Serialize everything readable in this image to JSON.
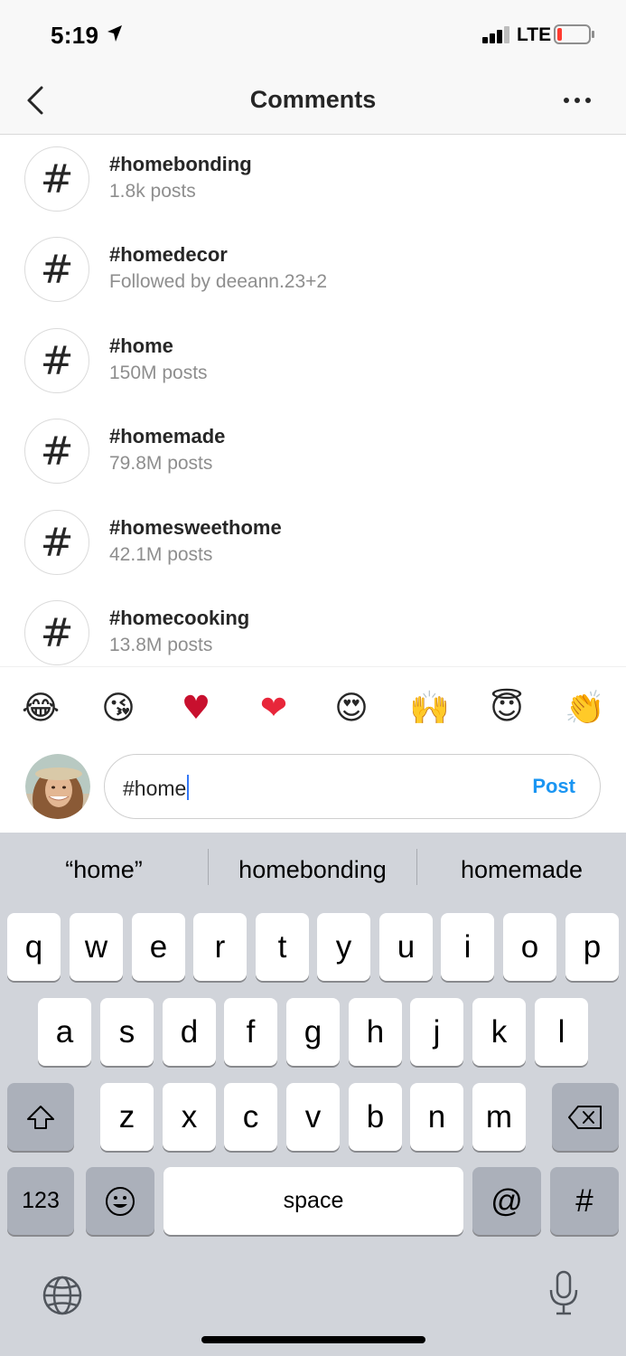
{
  "status_bar": {
    "time": "5:19",
    "network": "LTE"
  },
  "header": {
    "title": "Comments"
  },
  "hashtags": [
    {
      "tag": "#homebonding",
      "detail": "1.8k posts"
    },
    {
      "tag": "#homedecor",
      "detail": "Followed by deeann.23+2"
    },
    {
      "tag": "#home",
      "detail": "150M posts"
    },
    {
      "tag": "#homemade",
      "detail": "79.8M posts"
    },
    {
      "tag": "#homesweethome",
      "detail": "42.1M posts"
    },
    {
      "tag": "#homecooking",
      "detail": "13.8M posts"
    }
  ],
  "hash_symbol": "#",
  "emoji_bar": [
    "😂",
    "😘",
    "♥",
    "❤",
    "😍",
    "🙌",
    "😇",
    "👏"
  ],
  "comment": {
    "value": "#home",
    "post_label": "Post"
  },
  "keyboard": {
    "suggestions": [
      "“home”",
      "homebonding",
      "homemade"
    ],
    "row1": [
      "q",
      "w",
      "e",
      "r",
      "t",
      "y",
      "u",
      "i",
      "o",
      "p"
    ],
    "row2": [
      "a",
      "s",
      "d",
      "f",
      "g",
      "h",
      "j",
      "k",
      "l"
    ],
    "row3": [
      "z",
      "x",
      "c",
      "v",
      "b",
      "n",
      "m"
    ],
    "numbers_label": "123",
    "space_label": "space",
    "at_label": "@",
    "hash_label": "#"
  },
  "icons": [
    "location-arrow-icon",
    "signal-icon",
    "battery-icon",
    "back-chevron-icon",
    "more-icon",
    "shift-icon",
    "delete-icon",
    "emoji-icon",
    "globe-icon",
    "microphone-icon"
  ]
}
